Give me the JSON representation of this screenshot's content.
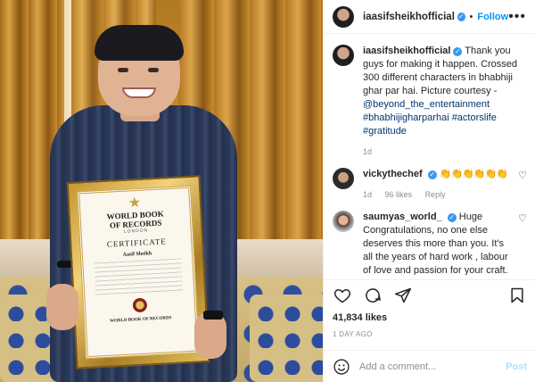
{
  "post": {
    "author": "iaasifsheikhofficial",
    "follow_label": "Follow",
    "dot": "•",
    "more": "•••"
  },
  "certificate": {
    "org_line1": "WORLD BOOK",
    "org_line2": "OF RECORDS",
    "org_city": "LONDON",
    "heading": "CERTIFICATE",
    "recipient": "Aasif Sheikh",
    "footer": "WORLD BOOK OF RECORDS"
  },
  "caption": {
    "user": "iaasifsheikhofficial",
    "text": "Thank you guys for making it happen. Crossed 300 different characters in bhabhiji ghar par hai. Picture courtesy -",
    "mention": "@beyond_the_entertainment",
    "hashtags": "#bhabhijigharparhai #actorslife #gratitude",
    "time": "1d"
  },
  "comments": [
    {
      "user": "vickythechef",
      "text": "👏👏👏👏👏👏",
      "time": "1d",
      "likes": "96 likes",
      "reply": "Reply"
    },
    {
      "user": "saumyas_world_",
      "text": "Huge Congratulations, no one else deserves this more than you. It's all the years of hard work , labour of love and passion for your craft. Super proud"
    }
  ],
  "stats": {
    "likes": "41,834 likes",
    "time": "1 DAY AGO"
  },
  "composer": {
    "placeholder": "Add a comment...",
    "post_label": "Post"
  },
  "colors": {
    "accent": "#0095f6",
    "verified": "#3897f0",
    "link": "#00376b",
    "muted": "#8e8e8e"
  }
}
